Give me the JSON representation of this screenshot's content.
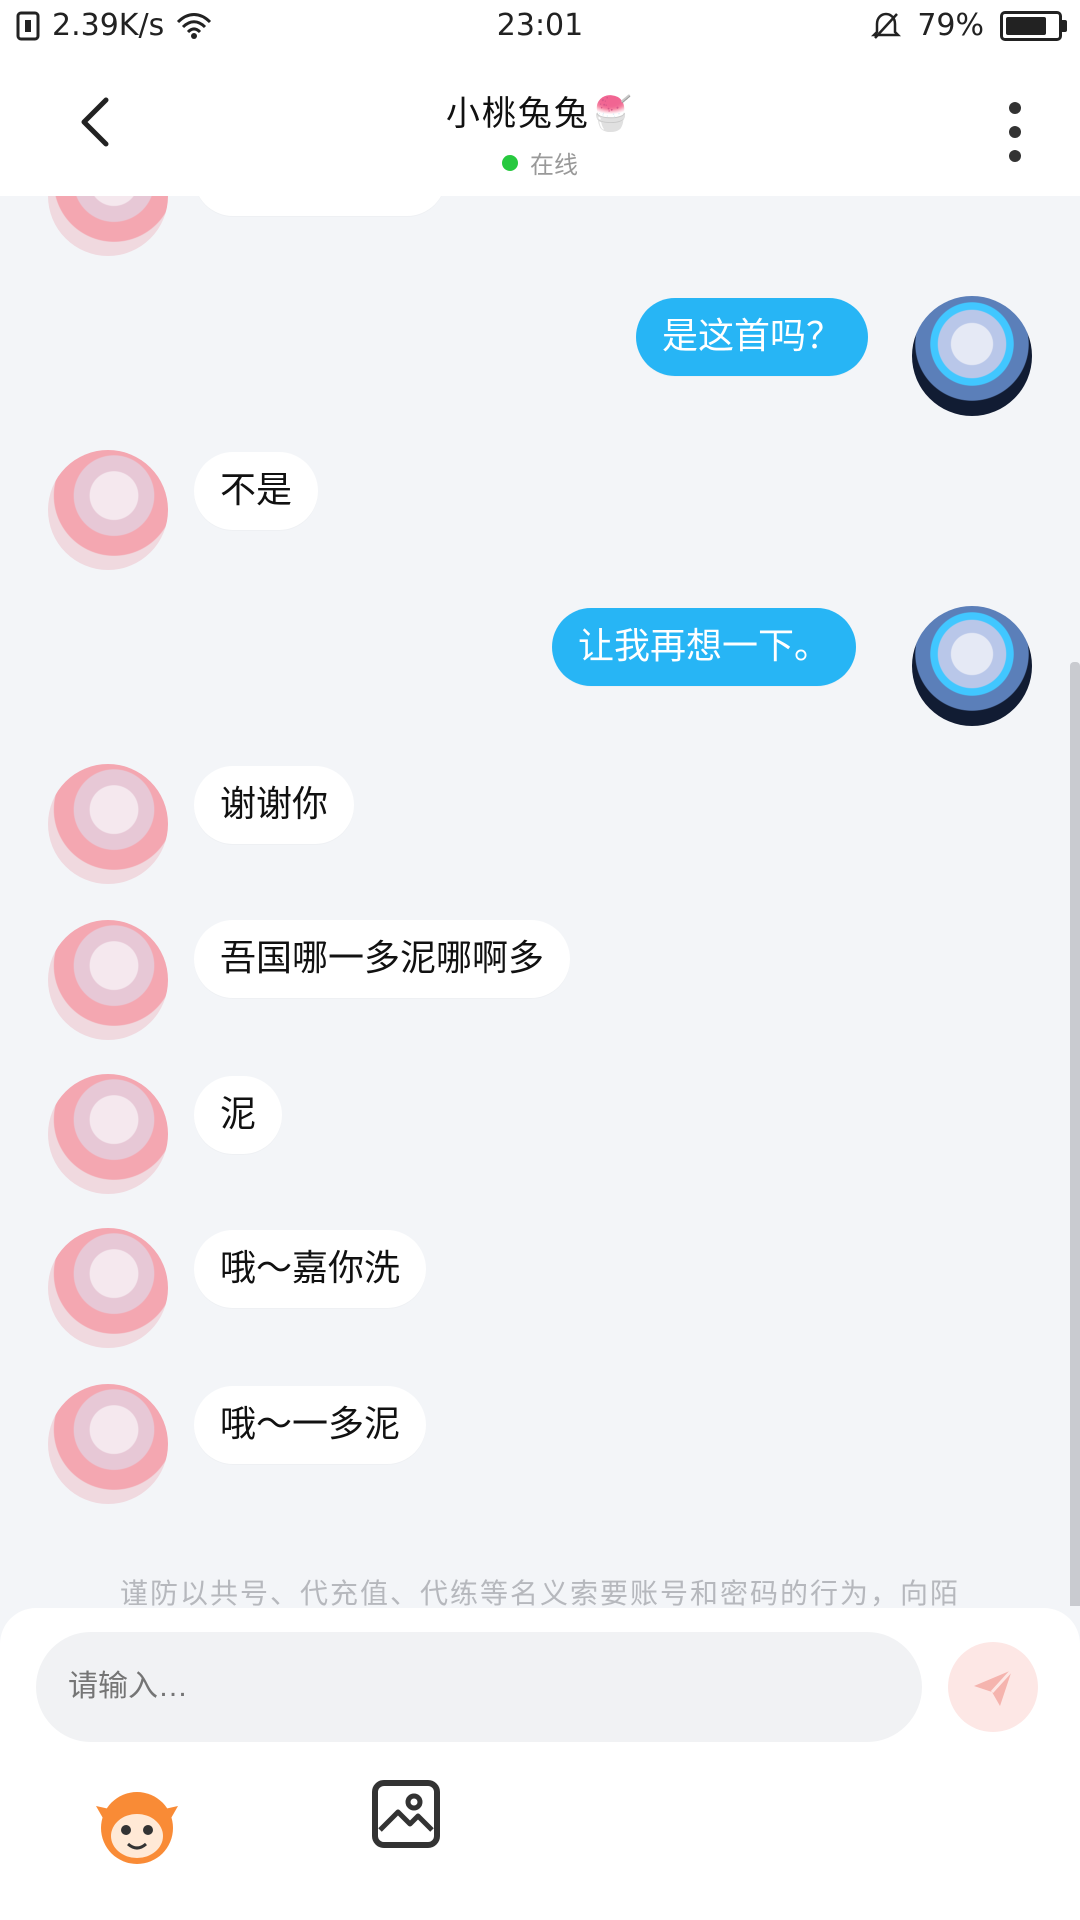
{
  "status": {
    "net_speed": "2.39K/s",
    "time": "23:01",
    "battery": "79%",
    "battery_level": 0.79
  },
  "header": {
    "title": "小桃兔兔🍧",
    "status": "在线"
  },
  "messages": [
    {
      "side": "left",
      "text": ""
    },
    {
      "side": "right",
      "text": "是这首吗？"
    },
    {
      "side": "left",
      "text": "不是"
    },
    {
      "side": "right",
      "text": "让我再想一下。"
    },
    {
      "side": "left",
      "text": "谢谢你"
    },
    {
      "side": "left",
      "text": "吾国哪一多泥哪啊多"
    },
    {
      "side": "left",
      "text": "泥"
    },
    {
      "side": "left",
      "text": "哦～嘉你洗"
    },
    {
      "side": "left",
      "text": "哦～一多泥"
    }
  ],
  "notice": "谨防以共号、代充值、代练等名义索要账号和密码的行为，向陌",
  "input": {
    "placeholder": "请输入…"
  },
  "colors": {
    "accent": "#27b5f5",
    "online": "#27c93f",
    "bg": "#f3f5f8"
  },
  "icons": [
    "back-icon",
    "more-icon",
    "send-icon",
    "mascot-icon",
    "image-icon",
    "wifi-icon",
    "bell-muted-icon",
    "sim-icon"
  ]
}
